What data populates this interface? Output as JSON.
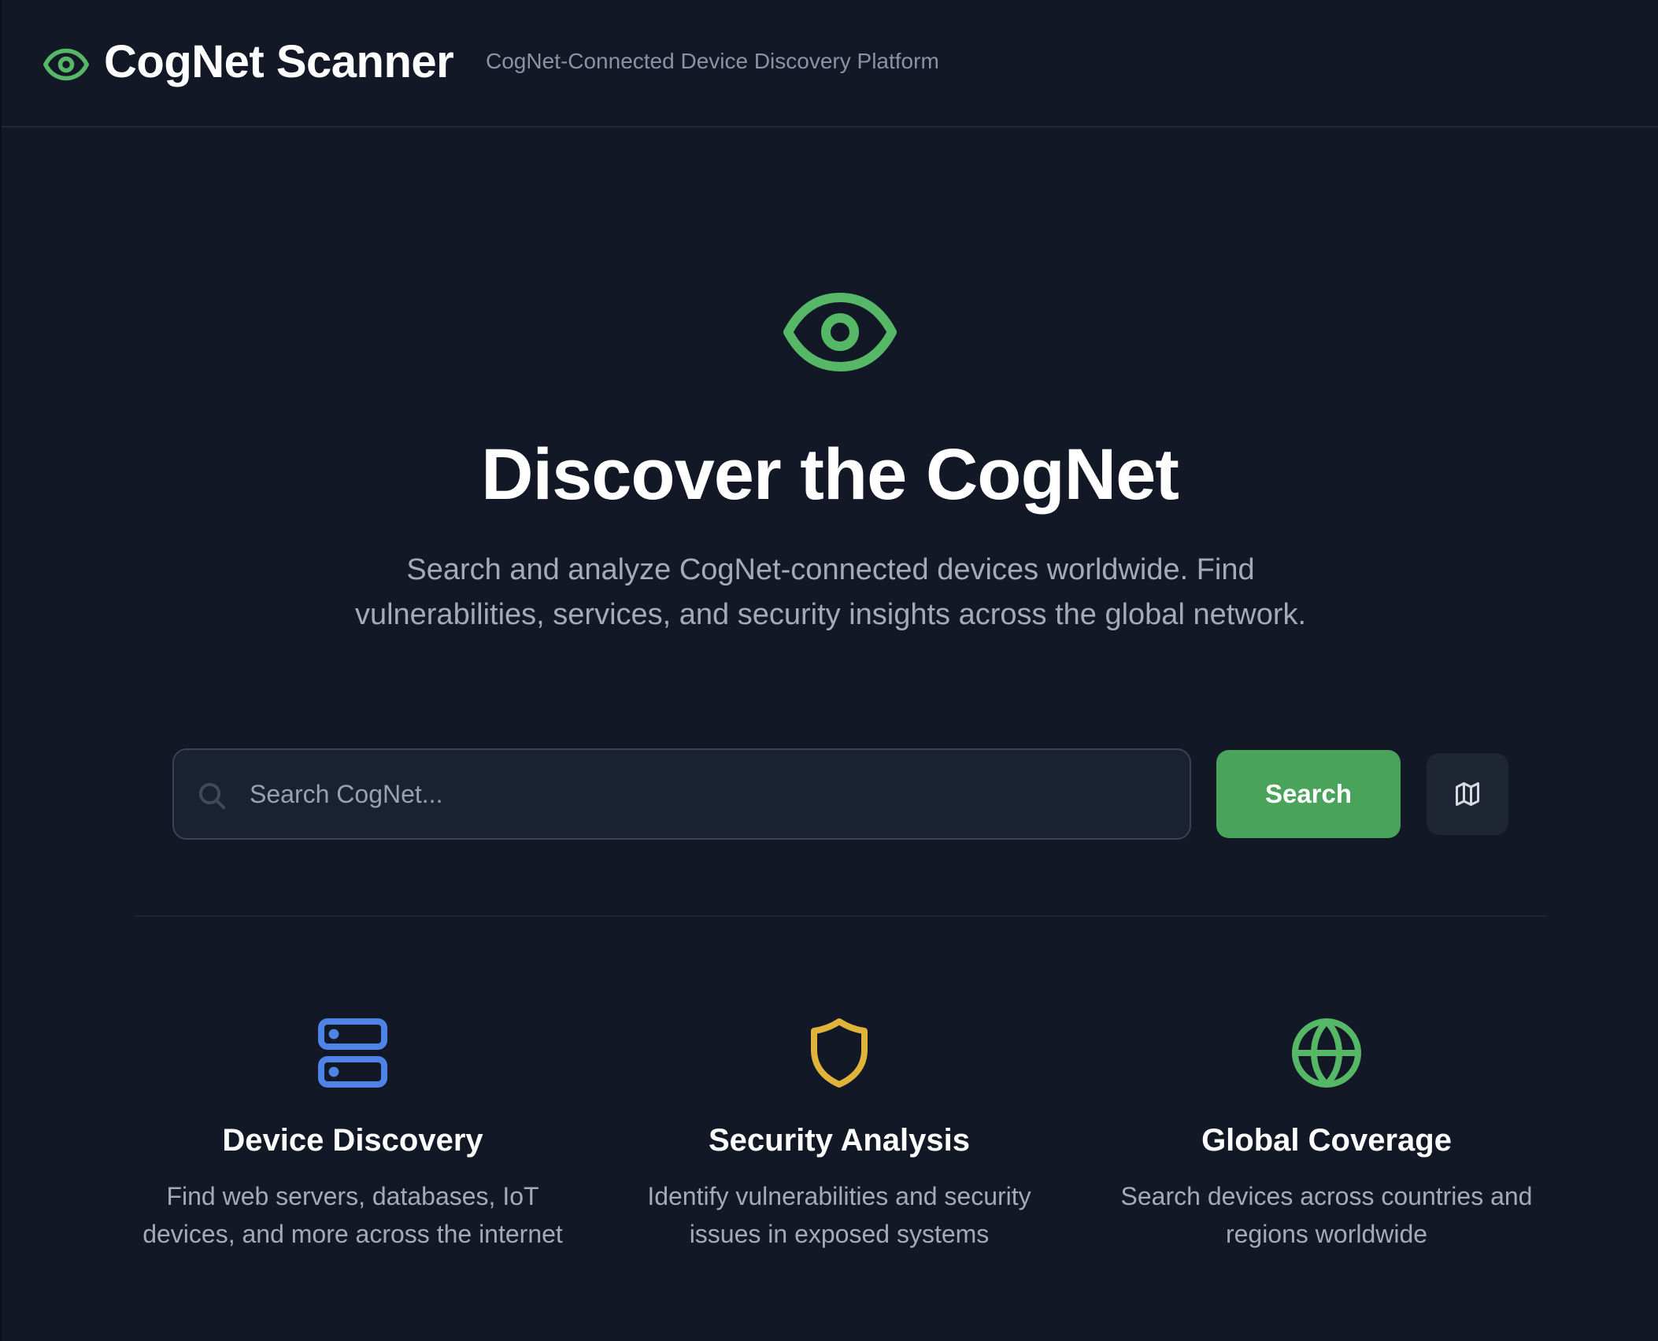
{
  "header": {
    "brand_name": "CogNet Scanner",
    "tagline": "CogNet-Connected Device Discovery Platform",
    "brand_icon": "eye-icon"
  },
  "hero": {
    "icon": "eye-icon",
    "title": "Discover the CogNet",
    "description": "Search and analyze CogNet-connected devices worldwide. Find vulnerabilities, services, and security insights across the global network."
  },
  "search": {
    "placeholder": "Search CogNet...",
    "value": "",
    "button_label": "Search",
    "map_button_icon": "map-icon"
  },
  "features": [
    {
      "icon": "server-icon",
      "icon_color": "#4f83e6",
      "title": "Device Discovery",
      "description": "Find web servers, databases, IoT devices, and more across the internet"
    },
    {
      "icon": "shield-icon",
      "icon_color": "#e0b33a",
      "title": "Security Analysis",
      "description": "Identify vulnerabilities and security issues in exposed systems"
    },
    {
      "icon": "globe-icon",
      "icon_color": "#56b866",
      "title": "Global Coverage",
      "description": "Search devices across countries and regions worldwide"
    }
  ],
  "colors": {
    "background": "#121826",
    "accent_green": "#4aa35a",
    "icon_green": "#56b866",
    "muted_text": "#a3aab8"
  }
}
